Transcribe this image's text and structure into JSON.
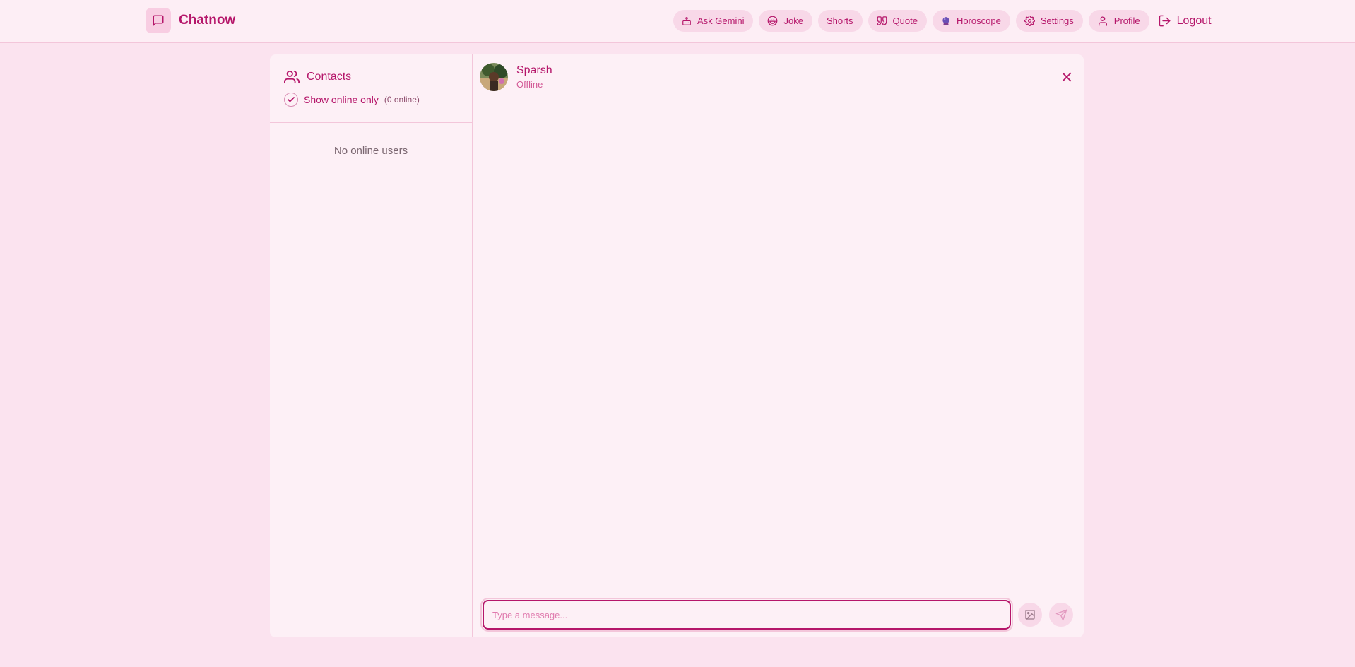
{
  "brand": {
    "name": "Chatnow",
    "logo_icon": "message-square-icon"
  },
  "nav": {
    "items": [
      {
        "label": "Ask Gemini",
        "icon": "bot-icon"
      },
      {
        "label": "Joke",
        "icon": "laugh-icon"
      },
      {
        "label": "Shorts",
        "icon": ""
      },
      {
        "label": "Quote",
        "icon": "quote-icon"
      },
      {
        "label": "Horoscope",
        "icon": "crystal-ball-icon"
      },
      {
        "label": "Settings",
        "icon": "gear-icon"
      },
      {
        "label": "Profile",
        "icon": "user-icon"
      }
    ],
    "logout_label": "Logout"
  },
  "sidebar": {
    "title": "Contacts",
    "filter_label": "Show online only",
    "filter_checked": true,
    "online_count": "(0 online)",
    "empty_text": "No online users"
  },
  "chat": {
    "peer_name": "Sparsh",
    "peer_status": "Offline",
    "input_placeholder": "Type a message..."
  },
  "colors": {
    "page_bg": "#fbe3ef",
    "panel_bg": "#fdf0f6",
    "accent": "#b5166a",
    "pill_bg": "#f8d8e8"
  }
}
